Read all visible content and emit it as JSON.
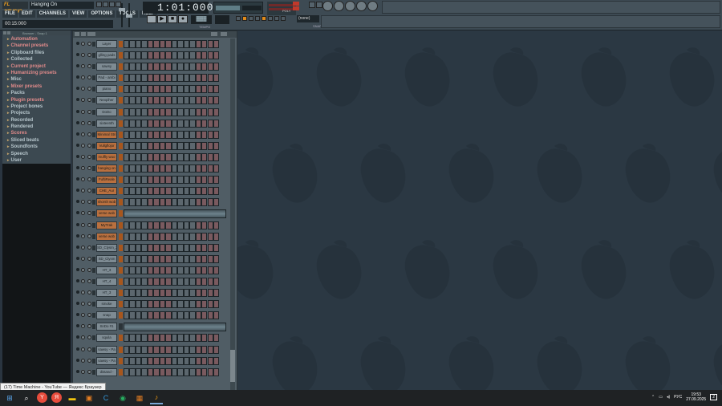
{
  "app": {
    "name": "FL STUDIO",
    "song_title": "Hanging On"
  },
  "menu": [
    "FILE",
    "EDIT",
    "CHANNELS",
    "VIEW",
    "OPTIONS",
    "TOOLS",
    "HELP"
  ],
  "time_display": "00:15:000",
  "lcd_position": "1:01:000",
  "labels": {
    "tempo": "TEMPO",
    "poly": "POLY",
    "snap": "SNAP",
    "none": "(none)"
  },
  "browser": {
    "header": "Browser - Snap 1",
    "items": [
      {
        "label": "Automation",
        "color": "#e28b8b"
      },
      {
        "label": "Channel presets",
        "color": "#e28b8b"
      },
      {
        "label": "Clipboard files",
        "color": "#b7c6cc"
      },
      {
        "label": "Collected",
        "color": "#b7c6cc"
      },
      {
        "label": "Current project",
        "color": "#e28b8b"
      },
      {
        "label": "Humanizing presets",
        "color": "#e28b8b"
      },
      {
        "label": "Misc",
        "color": "#b7c6cc"
      },
      {
        "label": "Mixer presets",
        "color": "#e28b8b"
      },
      {
        "label": "Packs",
        "color": "#b7c6cc"
      },
      {
        "label": "Plugin presets",
        "color": "#e28b8b"
      },
      {
        "label": "Project bones",
        "color": "#b7c6cc"
      },
      {
        "label": "Projects",
        "color": "#b7c6cc"
      },
      {
        "label": "Recorded",
        "color": "#b7c6cc"
      },
      {
        "label": "Rendered",
        "color": "#b7c6cc"
      },
      {
        "label": "Scores",
        "color": "#e28b8b"
      },
      {
        "label": "Sliced beats",
        "color": "#b7c6cc"
      },
      {
        "label": "Soundfonts",
        "color": "#b7c6cc"
      },
      {
        "label": "Speech",
        "color": "#b7c6cc"
      },
      {
        "label": "User",
        "color": "#b7c6cc"
      }
    ]
  },
  "channels": [
    {
      "name": "Layer",
      "style": "blue",
      "selected": true
    },
    {
      "name": "glling pads",
      "style": "blue",
      "selected": true
    },
    {
      "name": "sawsy",
      "style": "blue",
      "selected": true
    },
    {
      "name": "Pad - ambi",
      "style": "blue",
      "selected": true
    },
    {
      "name": "piano",
      "style": "blue",
      "selected": true
    },
    {
      "name": "Nexpiher",
      "style": "blue",
      "selected": true
    },
    {
      "name": "DoDo",
      "style": "blue",
      "selected": true
    },
    {
      "name": "sixteenth",
      "style": "blue",
      "selected": true
    },
    {
      "name": "Minimal Stri",
      "style": "orange",
      "selected": true
    },
    {
      "name": "Vullgflojor",
      "style": "orange",
      "selected": true
    },
    {
      "name": "muffly wuo",
      "style": "orange",
      "selected": true
    },
    {
      "name": "hanging on",
      "style": "orange",
      "selected": true
    },
    {
      "name": "FuftiReale",
      "style": "orange",
      "selected": true
    },
    {
      "name": "CHE_Aur",
      "style": "orange",
      "selected": true
    },
    {
      "name": "shorsh wob",
      "style": "orange",
      "selected": true
    },
    {
      "name": "verse wob",
      "style": "orange",
      "selected": true,
      "audio": true
    },
    {
      "name": "MyTrak",
      "style": "orange",
      "selected": true
    },
    {
      "name": "verse wob",
      "style": "orange",
      "selected": true
    },
    {
      "name": "SD_Clysm_2",
      "style": "blue",
      "selected": true
    },
    {
      "name": "SD_Clysm",
      "style": "blue",
      "selected": true
    },
    {
      "name": "HT_3",
      "style": "blue",
      "selected": true
    },
    {
      "name": "HT_4",
      "style": "blue",
      "selected": true
    },
    {
      "name": "HT_3",
      "style": "blue",
      "selected": true
    },
    {
      "name": "smoke",
      "style": "blue",
      "selected": true
    },
    {
      "name": "snap",
      "style": "blue",
      "selected": true
    },
    {
      "name": "SnDo #1",
      "style": "blue",
      "selected": false,
      "audio": true
    },
    {
      "name": "squila",
      "style": "blue",
      "selected": true
    },
    {
      "name": "sawsy - Pa",
      "style": "blue",
      "selected": true
    },
    {
      "name": "sawsy - Pa",
      "style": "blue",
      "selected": true
    },
    {
      "name": "distand - ",
      "style": "blue",
      "selected": true
    }
  ],
  "taskbar": {
    "tooltip": "(17) Time Machine - YouTube — Яндекс Браузер",
    "lang": "РУС",
    "time": "19:53",
    "date": "27.09.2025",
    "notifications": "2"
  }
}
